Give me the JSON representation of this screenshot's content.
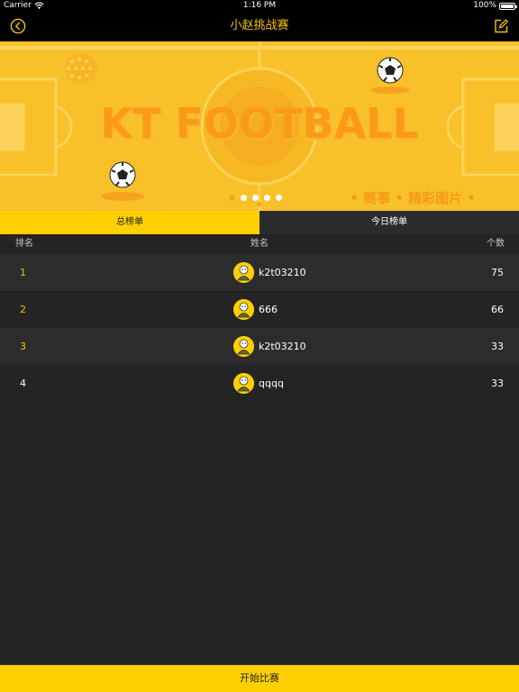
{
  "status_bar": {
    "carrier": "Carrier",
    "time": "1:16 PM",
    "battery": "100%"
  },
  "nav": {
    "title": "小赵挑战赛",
    "back_icon": "chevron-left-circle-icon",
    "edit_icon": "edit-square-icon"
  },
  "banner": {
    "title": "KT FOOTBALL",
    "caption": "• 赛事 • 精彩图片 •",
    "page_count": 5,
    "active_page": 0
  },
  "tabs": [
    {
      "label": "总榜单",
      "active": true
    },
    {
      "label": "今日榜单",
      "active": false
    }
  ],
  "table": {
    "headers": {
      "rank": "排名",
      "name": "姓名",
      "count": "个数"
    },
    "rows": [
      {
        "rank": "1",
        "name": "k2t03210",
        "count": "75"
      },
      {
        "rank": "2",
        "name": "666",
        "count": "66"
      },
      {
        "rank": "3",
        "name": "k2t03210",
        "count": "33"
      },
      {
        "rank": "4",
        "name": "qqqq",
        "count": "33"
      }
    ]
  },
  "footer": {
    "start_label": "开始比赛"
  },
  "colors": {
    "accent": "#ffd000",
    "nav_title": "#f5c400",
    "background": "#242424"
  }
}
